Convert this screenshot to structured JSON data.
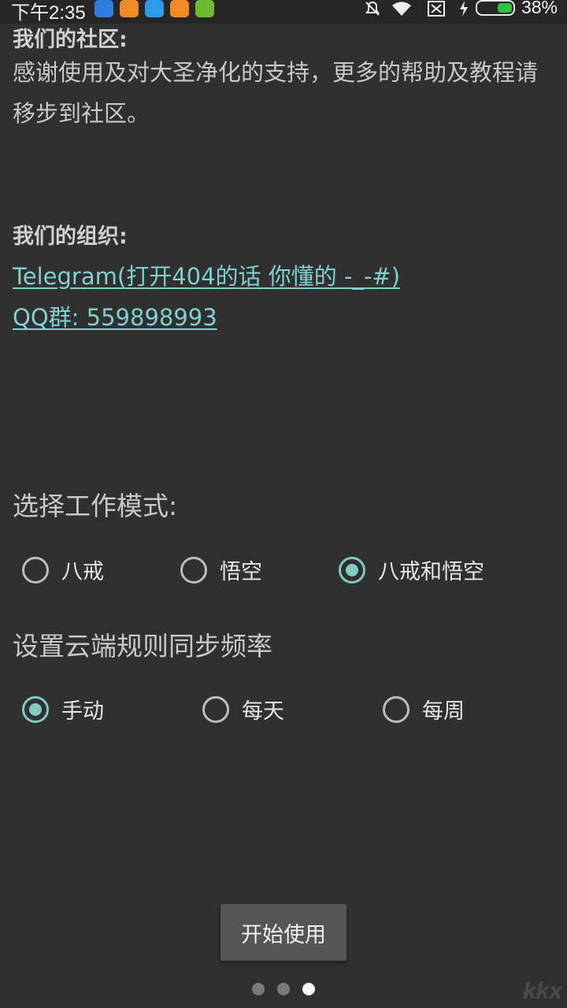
{
  "status_bar": {
    "time": "下午2:35",
    "battery_text": "38%",
    "battery_level_percent": 38,
    "icons": [
      "shield-app-icon",
      "weibo-app-icon",
      "bird-app-icon",
      "weibo-app-icon",
      "phone-app-icon",
      "mute-icon",
      "wifi-icon",
      "no-sim-icon",
      "charging-icon",
      "battery-icon"
    ]
  },
  "community": {
    "heading": "我们的社区:",
    "body": "感谢使用及对大圣净化的支持，更多的帮助及教程请移步到社区。"
  },
  "organization": {
    "heading": "我们的组织:",
    "telegram_link": "Telegram(打开404的话 你懂的 -_-#)",
    "qq_link": "QQ群: 559898993"
  },
  "work_mode": {
    "title": "选择工作模式:",
    "options": [
      "八戒",
      "悟空",
      "八戒和悟空"
    ],
    "selected": "八戒和悟空"
  },
  "sync_frequency": {
    "title": "设置云端规则同步频率",
    "options": [
      "手动",
      "每天",
      "每周"
    ],
    "selected": "手动"
  },
  "start_button": "开始使用",
  "pager": {
    "count": 3,
    "current": 3
  },
  "colors": {
    "background": "#303030",
    "accent": "#80cbc4",
    "link": "#7fd0cf"
  }
}
